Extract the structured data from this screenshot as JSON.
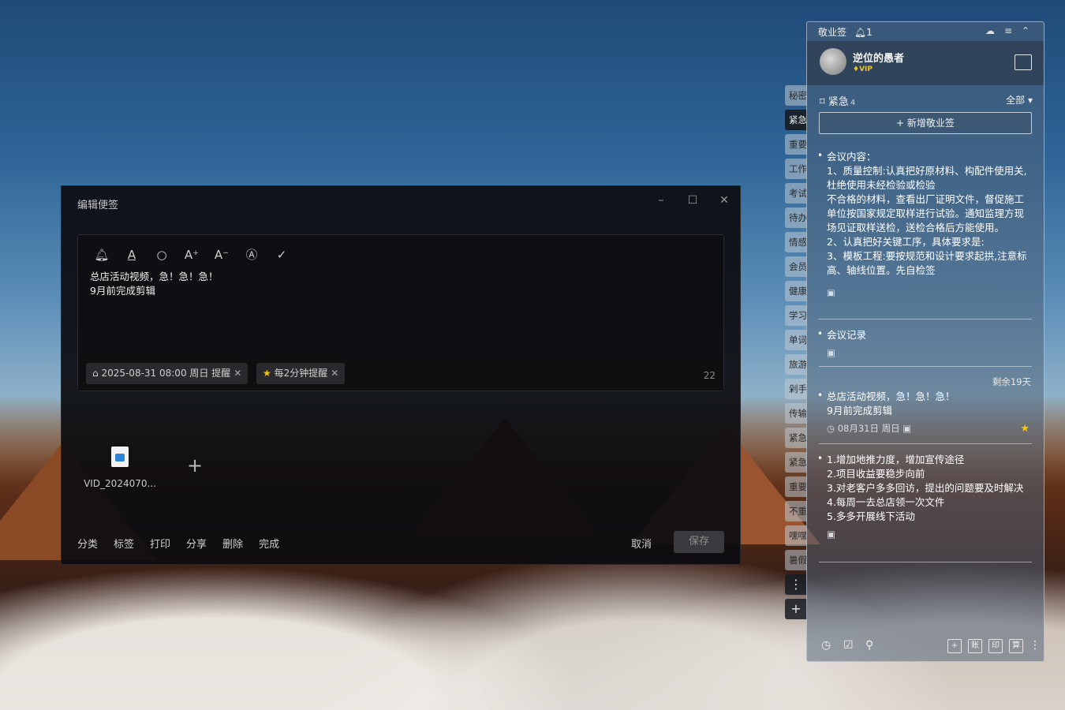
{
  "editor": {
    "title": "编辑便签",
    "text_line1": "总店活动视频，急！急！急！",
    "text_line2": "9月前完成剪辑",
    "reminder_chip": "2025-08-31 08:00 周日 提醒",
    "repeat_chip": "每2分钟提醒",
    "char_count": "22",
    "attachment_name": "VID_2024070...",
    "bottom_actions": [
      "分类",
      "标签",
      "打印",
      "分享",
      "删除",
      "完成"
    ],
    "cancel_label": "取消",
    "save_label": "保存"
  },
  "side_tabs": [
    "秘密",
    "紧急",
    "重要",
    "工作",
    "考试",
    "待办",
    "情感",
    "会员",
    "健康",
    "学习",
    "单词",
    "旅游",
    "剁手",
    "传输",
    "紧急",
    "紧急",
    "重要",
    "不重",
    "嘿嘿",
    "暑假"
  ],
  "panel": {
    "app_name": "敬业签",
    "bell_count": "1",
    "user_name": "逆位的愚者",
    "vip_label": "VIP",
    "category_name": "紧急",
    "category_count": "4",
    "filter_label": "全部",
    "new_note_label": "新增敬业签",
    "notes": [
      {
        "lines": [
          "会议内容：",
          "1、质量控制:认真把好原材料、构配件使用关,杜绝使用未经检验或检验",
          "不合格的材料，查看出厂证明文件，督促施工单位按国家规定取样进行试验。通知监理方现场见证取样送检，送检合格后方能使用。",
          "2、认真把好关键工序，具体要求是:",
          "3、模板工程:要按规范和设计要求起拱,注意标高、轴线位置。先自检签"
        ]
      },
      {
        "lines": [
          "会议记录"
        ]
      },
      {
        "remain": "剩余19天",
        "lines": [
          "总店活动视频，急！急！急！",
          "9月前完成剪辑"
        ],
        "date": "08月31日 周日"
      },
      {
        "lines": [
          "1.增加地推力度，增加宣传途径",
          "2.项目收益要稳步向前",
          "3.对老客户多多回访，提出的问题要及时解决",
          "4.每周一去总店领一次文件",
          "5.多多开展线下活动"
        ]
      }
    ],
    "bottom_tools": [
      "账",
      "印",
      "算"
    ]
  }
}
